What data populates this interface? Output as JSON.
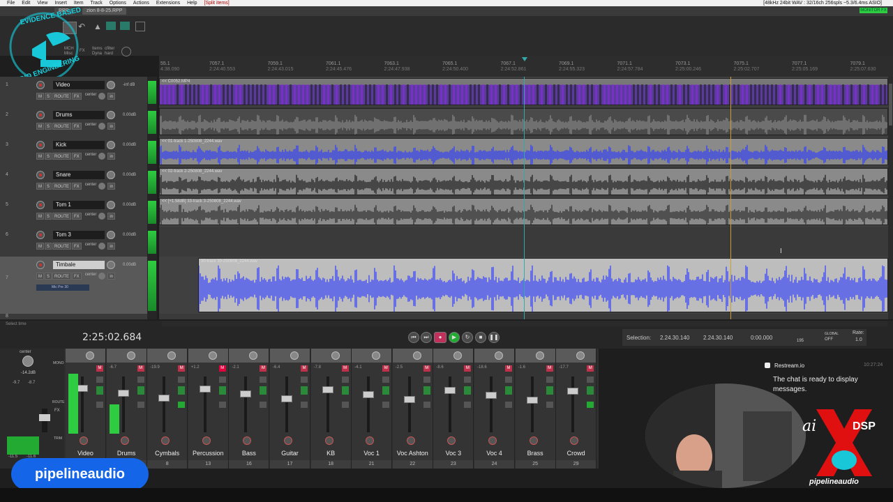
{
  "menubar": {
    "items": [
      "File",
      "Edit",
      "View",
      "Insert",
      "Item",
      "Track",
      "Options",
      "Actions",
      "Extensions",
      "Help"
    ],
    "status": "[Split items]",
    "audio_info": "[48kHz 24bit WAV : 32/16ch 256spls ~5.3/6.4ms ASIO]",
    "monitor": "MONITOR FX"
  },
  "tabs": [
    "RPP",
    "zion 8-8-25.RPP"
  ],
  "logo": {
    "line1": "EVIDENCE BASED",
    "line2": "AUDIO ENGINEERING"
  },
  "toolbar": {
    "labels": [
      "MCH",
      "Misc",
      "FX",
      "Items",
      "Dyna",
      "cfilter",
      "hard"
    ]
  },
  "ruler": {
    "marks": [
      {
        "bar": "55.1",
        "time": "4:38.090"
      },
      {
        "bar": "7057.1",
        "time": "2:24:40.553"
      },
      {
        "bar": "7059.1",
        "time": "2:24:43.015"
      },
      {
        "bar": "7061.1",
        "time": "2:24:45.476"
      },
      {
        "bar": "7063.1",
        "time": "2:24:47.938"
      },
      {
        "bar": "7065.1",
        "time": "2:24:50.400"
      },
      {
        "bar": "7067.1",
        "time": "2:24:52.861"
      },
      {
        "bar": "7069.1",
        "time": "2:24:55.323"
      },
      {
        "bar": "7071.1",
        "time": "2:24:57.784"
      },
      {
        "bar": "7073.1",
        "time": "2:25:00.246"
      },
      {
        "bar": "7075.1",
        "time": "2:25:02.707"
      },
      {
        "bar": "7077.1",
        "time": "2:25:05.169"
      },
      {
        "bar": "7079.1",
        "time": "2:25:07.630"
      }
    ]
  },
  "tracks": [
    {
      "num": "1",
      "name": "Video",
      "vol": "-inf dB",
      "pan": "center",
      "item": "<< C0052.MP4"
    },
    {
      "num": "2",
      "name": "Drums",
      "vol": "0.00dB",
      "pan": "center",
      "item": ""
    },
    {
      "num": "3",
      "name": "Kick",
      "vol": "0.00dB",
      "pan": "center",
      "item": "<< 01-track 1-250808_2244.wav"
    },
    {
      "num": "4",
      "name": "Snare",
      "vol": "0.00dB",
      "pan": "center",
      "item": "<< 02-track 2-250808_2244.wav"
    },
    {
      "num": "5",
      "name": "Tom 1",
      "vol": "0.00dB",
      "pan": "center",
      "item": "<< [+1.58dB] 33-track 3-250808_2244.wav"
    },
    {
      "num": "6",
      "name": "Tom 3",
      "vol": "0.00dB",
      "pan": "center",
      "item": ""
    },
    {
      "num": "7",
      "name": "Timbale",
      "vol": "0.00dB",
      "pan": "center",
      "item": "30-track 30-250808_2244.wav",
      "fx": "Mic Pre 30"
    },
    {
      "num": "8",
      "name": "Cymbals",
      "vol": "",
      "pan": "",
      "item": ""
    }
  ],
  "track_buttons": {
    "m": "M",
    "s": "S",
    "route": "ROUTE",
    "fx": "FX",
    "io": "in"
  },
  "transport": {
    "time": "2:25:02.684",
    "status": "Select time"
  },
  "selection": {
    "label": "Selection:",
    "start": "2.24.30.140",
    "end": "2.24.30.140",
    "length": "0:00.000",
    "bpm": "195",
    "global": "GLOBAL",
    "off": "OFF",
    "rate_label": "Rate:",
    "rate": "1.0"
  },
  "master": {
    "pan": "center",
    "db": "-14.2dB",
    "left": "-9.7",
    "right": "-8.7",
    "mono": "MONO",
    "route": "ROUTE",
    "fx": "FX",
    "trim": "TRIM",
    "peak_l": "-11.5",
    "peak_r": "-11.6"
  },
  "mixer": [
    {
      "name": "Video",
      "no": "",
      "db": "",
      "ms": "M"
    },
    {
      "name": "Drums",
      "no": "",
      "db": "-6.7",
      "ms": "M"
    },
    {
      "name": "Cymbals",
      "no": "8",
      "db": "-19.9",
      "ms": "M"
    },
    {
      "name": "Percussion",
      "no": "13",
      "db": "+1.2",
      "ms": "M"
    },
    {
      "name": "Bass",
      "no": "16",
      "db": "-2.1",
      "ms": "M"
    },
    {
      "name": "Guitar",
      "no": "17",
      "db": "-6.4",
      "ms": "M"
    },
    {
      "name": "KB",
      "no": "18",
      "db": "-7.8",
      "ms": "M"
    },
    {
      "name": "Voc 1",
      "no": "21",
      "db": "-4.1",
      "ms": "M"
    },
    {
      "name": "Voc Ashton",
      "no": "22",
      "db": "-2.5",
      "ms": "M"
    },
    {
      "name": "Voc 3",
      "no": "23",
      "db": "-8.6",
      "ms": "M"
    },
    {
      "name": "Voc 4",
      "no": "24",
      "db": "-18.6",
      "ms": "M"
    },
    {
      "name": "Brass",
      "no": "25",
      "db": "-1.6",
      "ms": "M"
    },
    {
      "name": "Crowd",
      "no": "29",
      "db": "-17.7",
      "ms": "M"
    }
  ],
  "chat": {
    "service": "Restream.io",
    "time": "10:27:24",
    "message": "The chat is ready to display messages."
  },
  "brand": {
    "label": "pipelineaudio",
    "sponsor_a": "ai",
    "sponsor_b": "DSP",
    "footer": "pipelineaudio"
  },
  "colors": {
    "accent": "#1565e8",
    "wave_blue": "#2f3cff",
    "wave_purple": "#8a2be2",
    "meter_green": "#2ecc40",
    "rec_red": "#e0003c"
  }
}
